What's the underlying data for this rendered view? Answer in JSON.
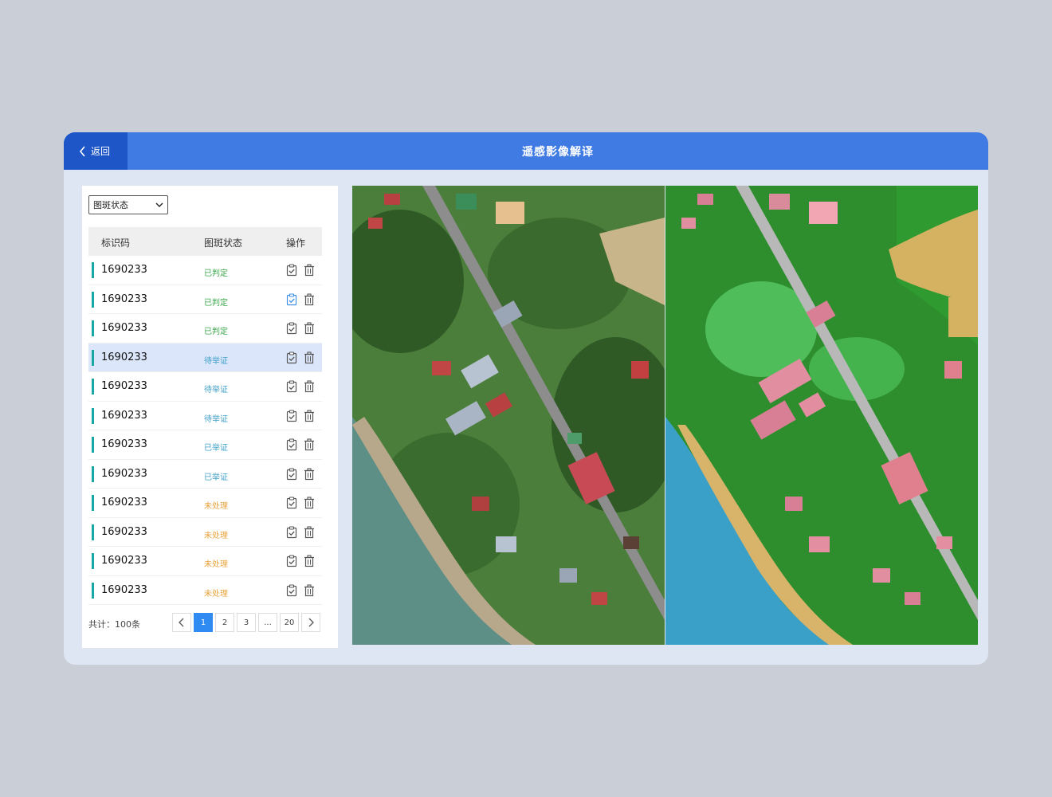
{
  "header": {
    "back_label": "返回",
    "title": "遥感影像解译"
  },
  "filter": {
    "status_select_value": "图斑状态"
  },
  "table": {
    "columns": [
      "标识码",
      "图斑状态",
      "操作"
    ],
    "rows": [
      {
        "code": "1690233",
        "status": "已判定",
        "tone": "green"
      },
      {
        "code": "1690233",
        "status": "已判定",
        "tone": "green"
      },
      {
        "code": "1690233",
        "status": "已判定",
        "tone": "green"
      },
      {
        "code": "1690233",
        "status": "待举证",
        "tone": "cyan"
      },
      {
        "code": "1690233",
        "status": "待举证",
        "tone": "cyan"
      },
      {
        "code": "1690233",
        "status": "待举证",
        "tone": "cyan"
      },
      {
        "code": "1690233",
        "status": "已举证",
        "tone": "cyan"
      },
      {
        "code": "1690233",
        "status": "已举证",
        "tone": "cyan"
      },
      {
        "code": "1690233",
        "status": "未处理",
        "tone": "orange"
      },
      {
        "code": "1690233",
        "status": "未处理",
        "tone": "orange"
      },
      {
        "code": "1690233",
        "status": "未处理",
        "tone": "orange"
      },
      {
        "code": "1690233",
        "status": "未处理",
        "tone": "orange"
      }
    ],
    "selected_row": 3,
    "highlighted_icon_row": 1
  },
  "pagination": {
    "total_label": "共计：100条",
    "pages": [
      "1",
      "2",
      "3",
      "...",
      "20"
    ],
    "current_page": "1"
  },
  "colors": {
    "header_blue": "#3f7be3",
    "back_blue": "#1e56c8",
    "status_green": "#3aa64a",
    "status_cyan": "#3fa0c8",
    "status_orange": "#e8a23a",
    "pager_active": "#2f8af2"
  },
  "icons": {
    "back": "chevron-left-icon",
    "dropdown": "chevron-down-icon",
    "verify": "clipboard-check-icon",
    "delete": "trash-icon",
    "prev": "chevron-left-icon",
    "next": "chevron-right-icon"
  }
}
